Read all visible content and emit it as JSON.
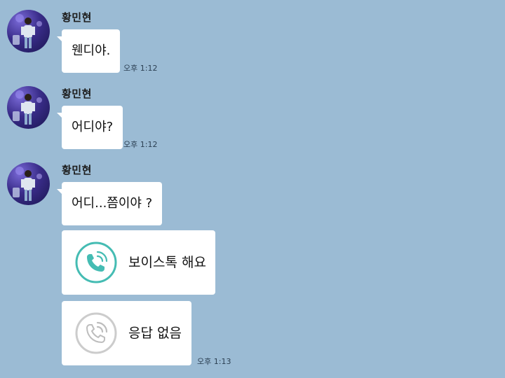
{
  "colors": {
    "background": "#9bbbd4",
    "bubble": "#ffffff",
    "call_accent": "#45bcb3",
    "call_missed": "#cccccc"
  },
  "messages": [
    {
      "sender": "황민현",
      "text": "웬디야.",
      "time": "오후 1:12"
    },
    {
      "sender": "황민현",
      "text": "어디야?",
      "time": "오후 1:12"
    },
    {
      "sender": "황민현",
      "text": "어디...쯤이야 ?",
      "time": ""
    }
  ],
  "calls": [
    {
      "label": "보이스톡 해요",
      "icon": "phone-call-icon",
      "state": "incoming"
    },
    {
      "label": "응답 없음",
      "icon": "phone-missed-icon",
      "state": "no-answer",
      "time": "오후 1:13"
    }
  ]
}
